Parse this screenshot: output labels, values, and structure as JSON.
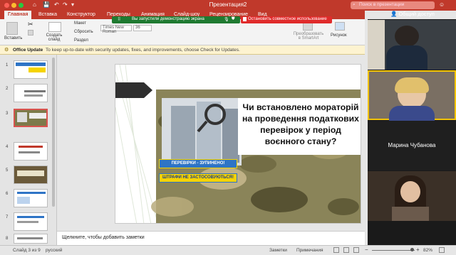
{
  "window": {
    "title": "Презентация2",
    "search_placeholder": "Поиск в презентации",
    "quick_access": [
      "⌂",
      "💾",
      "↶",
      "↷",
      "▾"
    ]
  },
  "tabs": [
    "Главная",
    "Вставка",
    "Конструктор",
    "Переходы",
    "Анимация",
    "Слайд-шоу",
    "Рецензирование",
    "Вид"
  ],
  "share_label": "Общий доступ",
  "ribbon": {
    "paste": "Вставить",
    "new_slide": "Создать слайд",
    "layout": "Макет",
    "reset": "Сбросить",
    "section": "Раздел",
    "font_name": "Times New Roman",
    "font_size": "36",
    "smartart": "Преобразовать в SmartArt",
    "picture": "Рисунок"
  },
  "zoom_share": {
    "sharing_text": "Вы запустили демонстрацию экрана",
    "stop_button": "Остановить совместное использование"
  },
  "banner": {
    "title": "Office Update",
    "text": "To keep up-to-date with security updates, fixes, and improvements, choose Check for Updates."
  },
  "slides": {
    "numbers": [
      "1",
      "2",
      "3",
      "4",
      "5",
      "6",
      "7",
      "8"
    ],
    "selected_index": 2
  },
  "slide": {
    "title": "Чи встановлено мораторій на проведення податкових перевірок у період воєнного стану?",
    "button1": "ПЕРЕВІРКИ - ЗУПИНЕНО!",
    "button2": "ШТРАФИ НЕ ЗАСТОСОВУЮТЬСЯ!"
  },
  "notes_placeholder": "Щелкните, чтобы добавить заметки",
  "status": {
    "slide_counter": "Слайд 3 из 9",
    "language": "русский",
    "notes": "Заметки",
    "comments": "Примечания",
    "zoom": "82%"
  },
  "participants": [
    {
      "name": "",
      "has_video": true
    },
    {
      "name": "",
      "has_video": true
    },
    {
      "name": "Марина Чубанова",
      "has_video": false
    },
    {
      "name": "",
      "has_video": true
    }
  ],
  "colors": {
    "accent": "#c0392b",
    "zoom_green": "#1f7a31",
    "stop_red": "#e02b2b",
    "slide_blue": "#2e74c6"
  }
}
